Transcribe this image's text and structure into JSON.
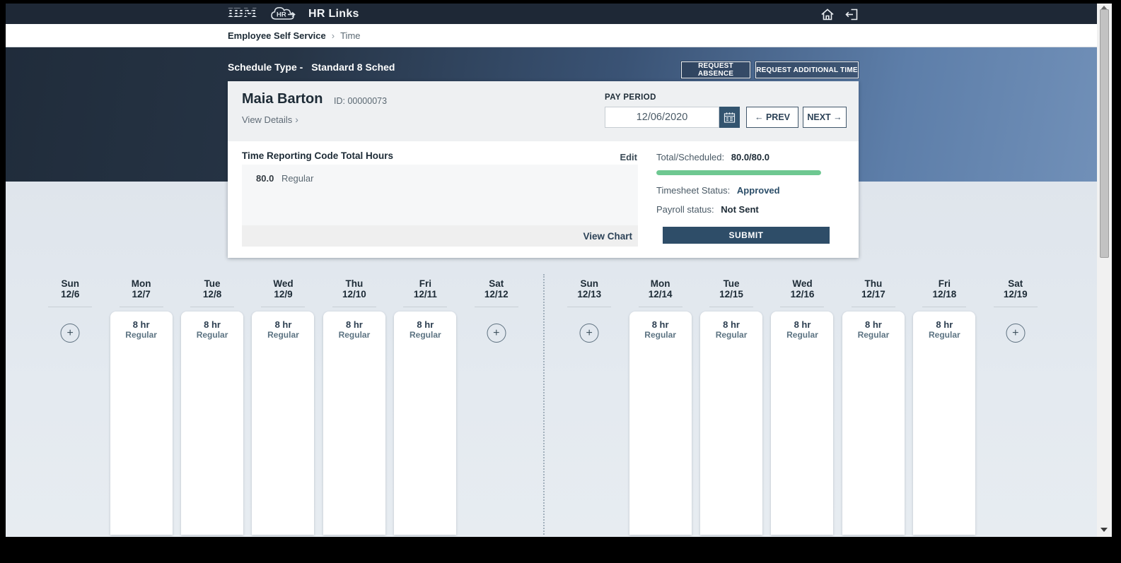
{
  "topbar": {
    "brand": "IBM",
    "title": "HR Links",
    "icons": {
      "logo_cloud": "hr-cloud-logo",
      "home": "home-icon",
      "signout": "sign-out-icon"
    }
  },
  "breadcrumb": {
    "root": "Employee Self Service",
    "separator": "›",
    "current": "Time"
  },
  "hero": {
    "schedule_type_label": "Schedule Type -",
    "schedule_type_value": "Standard 8 Sched",
    "request_absence": "REQUEST ABSENCE",
    "request_additional_time": "REQUEST ADDITIONAL TIME"
  },
  "card": {
    "name": "Maia Barton",
    "id": "ID: 00000073",
    "view_details": "View Details",
    "view_details_chevron": "›",
    "pay_period": {
      "label": "PAY PERIOD",
      "date": "12/06/2020",
      "prev": "PREV",
      "next": "NEXT",
      "prev_arrow": "←",
      "next_arrow": "→"
    },
    "trc": {
      "title": "Time Reporting Code Total Hours",
      "edit": "Edit",
      "rows": [
        {
          "hours": "80.0",
          "code": "Regular"
        }
      ],
      "view_chart": "View Chart"
    },
    "summary": {
      "total_label": "Total/Scheduled:",
      "total_value": "80.0/80.0",
      "progress_percent": 100,
      "progress_color": "#6ec891",
      "timesheet_label": "Timesheet Status:",
      "timesheet_value": "Approved",
      "timesheet_value_color": "#2b4d68",
      "payroll_label": "Payroll status:",
      "payroll_value": "Not Sent",
      "submit": "SUBMIT",
      "submit_color": "#2e4d68"
    }
  },
  "calendar": {
    "weeks": [
      {
        "days": [
          {
            "dow": "Sun",
            "date": "12/6",
            "type": "add"
          },
          {
            "dow": "Mon",
            "date": "12/7",
            "type": "entry",
            "hours": "8 hr",
            "code": "Regular"
          },
          {
            "dow": "Tue",
            "date": "12/8",
            "type": "entry",
            "hours": "8 hr",
            "code": "Regular"
          },
          {
            "dow": "Wed",
            "date": "12/9",
            "type": "entry",
            "hours": "8 hr",
            "code": "Regular"
          },
          {
            "dow": "Thu",
            "date": "12/10",
            "type": "entry",
            "hours": "8 hr",
            "code": "Regular"
          },
          {
            "dow": "Fri",
            "date": "12/11",
            "type": "entry",
            "hours": "8 hr",
            "code": "Regular"
          },
          {
            "dow": "Sat",
            "date": "12/12",
            "type": "add"
          }
        ]
      },
      {
        "days": [
          {
            "dow": "Sun",
            "date": "12/13",
            "type": "add"
          },
          {
            "dow": "Mon",
            "date": "12/14",
            "type": "entry",
            "hours": "8 hr",
            "code": "Regular"
          },
          {
            "dow": "Tue",
            "date": "12/15",
            "type": "entry",
            "hours": "8 hr",
            "code": "Regular"
          },
          {
            "dow": "Wed",
            "date": "12/16",
            "type": "entry",
            "hours": "8 hr",
            "code": "Regular"
          },
          {
            "dow": "Thu",
            "date": "12/17",
            "type": "entry",
            "hours": "8 hr",
            "code": "Regular"
          },
          {
            "dow": "Fri",
            "date": "12/18",
            "type": "entry",
            "hours": "8 hr",
            "code": "Regular"
          },
          {
            "dow": "Sat",
            "date": "12/19",
            "type": "add"
          }
        ]
      }
    ]
  }
}
